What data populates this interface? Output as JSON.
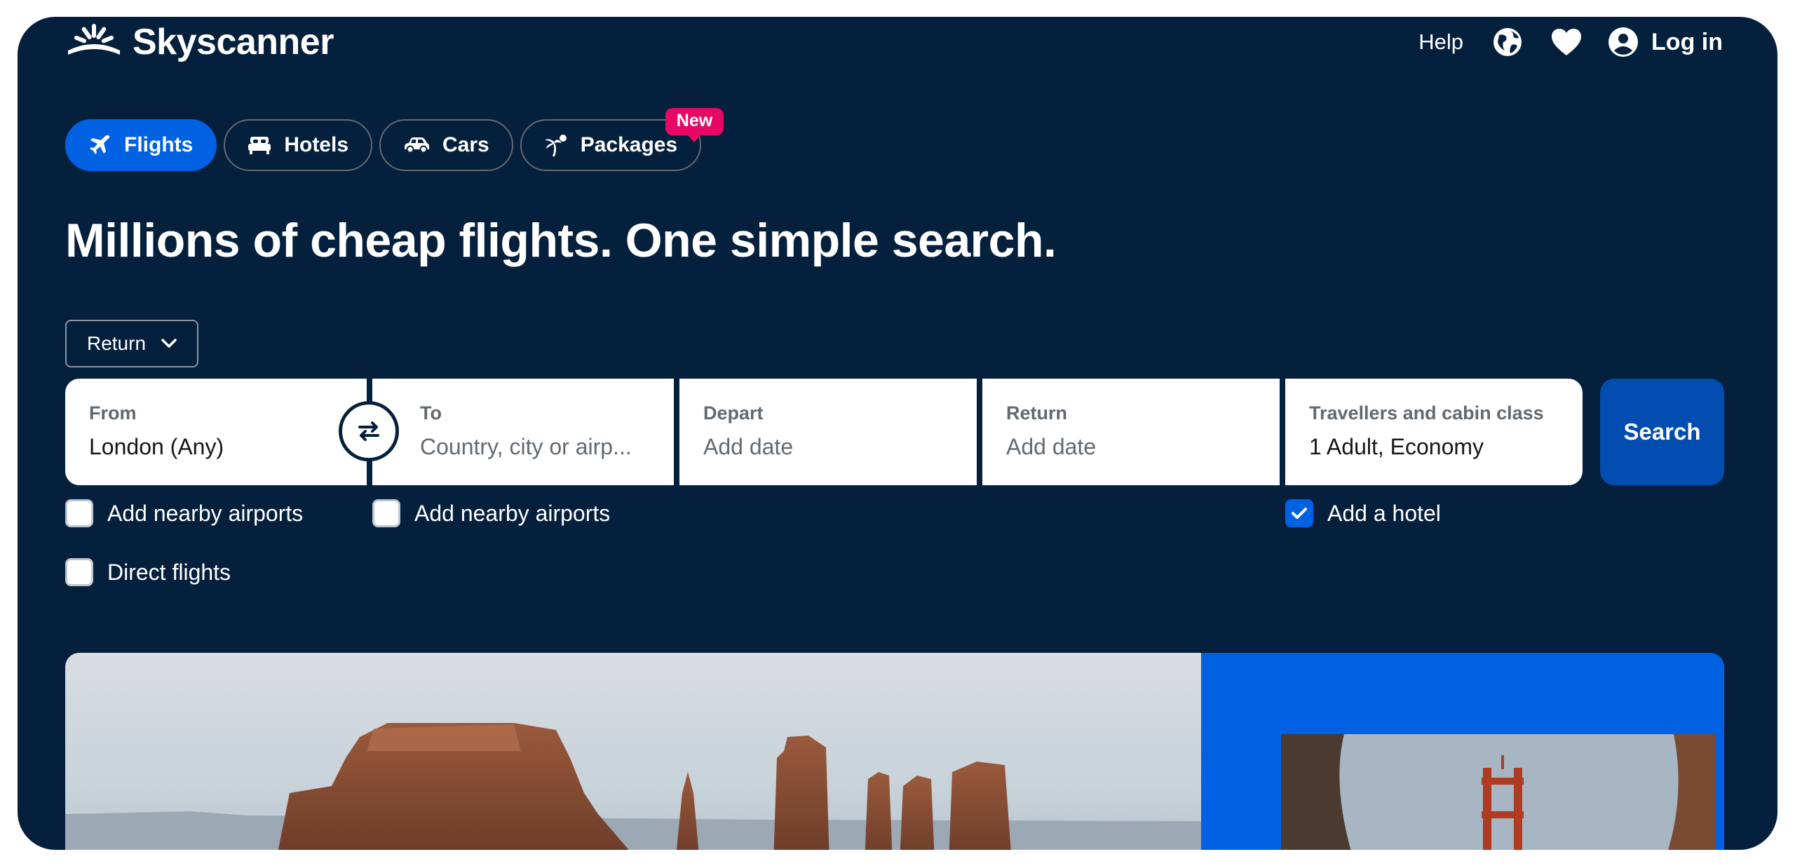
{
  "brand": {
    "name": "Skyscanner"
  },
  "header": {
    "help_label": "Help",
    "icons": [
      "globe-icon",
      "heart-icon",
      "account-icon"
    ],
    "login_label": "Log in"
  },
  "tabs": [
    {
      "label": "Flights",
      "icon": "plane-icon",
      "active": true
    },
    {
      "label": "Hotels",
      "icon": "bed-icon",
      "active": false
    },
    {
      "label": "Cars",
      "icon": "car-icon",
      "active": false
    },
    {
      "label": "Packages",
      "icon": "palm-tree-icon",
      "active": false,
      "badge": "New"
    }
  ],
  "headline": "Millions of cheap flights. One simple search.",
  "trip_type": {
    "selected": "Return"
  },
  "search": {
    "from": {
      "label": "From",
      "value": "London (Any)"
    },
    "to": {
      "label": "To",
      "placeholder": "Country, city or airp..."
    },
    "depart": {
      "label": "Depart",
      "placeholder": "Add date"
    },
    "return": {
      "label": "Return",
      "placeholder": "Add date"
    },
    "travellers": {
      "label": "Travellers and cabin class",
      "value": "1 Adult, Economy"
    },
    "button_label": "Search"
  },
  "options": {
    "from_nearby": {
      "label": "Add nearby airports",
      "checked": false
    },
    "to_nearby": {
      "label": "Add nearby airports",
      "checked": false
    },
    "add_hotel": {
      "label": "Add a hotel",
      "checked": true
    },
    "direct": {
      "label": "Direct flights",
      "checked": false
    }
  },
  "colors": {
    "background": "#05203c",
    "accent": "#0062e3",
    "search_button": "#024daf",
    "badge": "#e70866"
  }
}
